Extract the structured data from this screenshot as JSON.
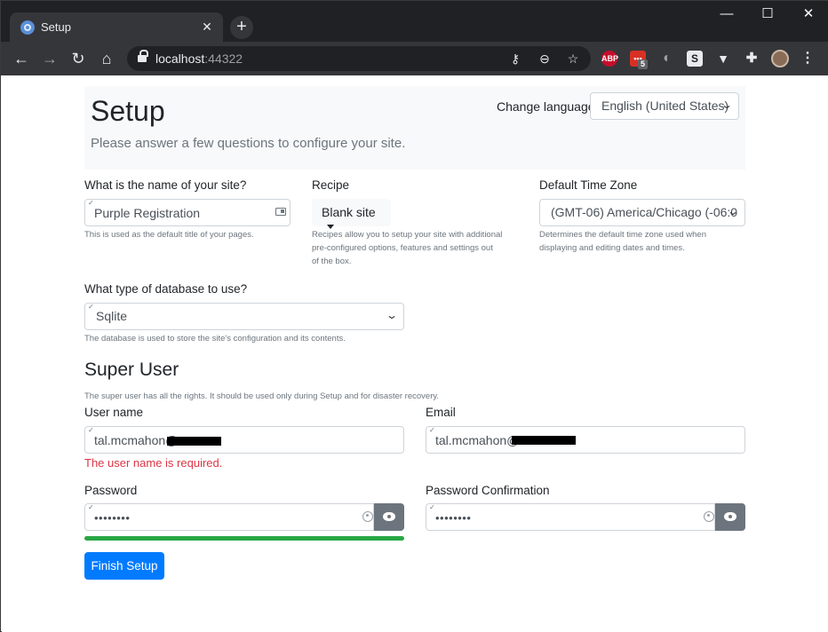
{
  "browser": {
    "tab_title": "Setup",
    "tab_close": "✕",
    "new_tab": "+",
    "url_host": "localhost",
    "url_port": ":44322",
    "controls": {
      "minimize": "—",
      "maximize": "☐",
      "close": "✕"
    },
    "extensions": {
      "abp": "ABP",
      "badge_count": "5",
      "s": "S"
    }
  },
  "header": {
    "title": "Setup",
    "subtitle": "Please answer a few questions to configure your site.",
    "language_label": "Change language",
    "language_value": "English (United States)"
  },
  "site": {
    "name_label": "What is the name of your site?",
    "name_value": "Purple Registration",
    "name_help": "This is used as the default title of your pages.",
    "recipe_label": "Recipe",
    "recipe_value": "Blank site",
    "recipe_help_1": "Recipes allow you to setup your site with additional",
    "recipe_help_2": "pre-configured options, features and settings out",
    "recipe_help_3": "of the box.",
    "tz_label": "Default Time Zone",
    "tz_value": "(GMT-06) America/Chicago (-06:0",
    "tz_help_1": "Determines the default time zone used when",
    "tz_help_2": "displaying and editing dates and times."
  },
  "database": {
    "label": "What type of database to use?",
    "value": "Sqlite",
    "help": "The database is used to store the site's configuration and its contents."
  },
  "super_user": {
    "heading": "Super User",
    "help": "The super user has all the rights. It should be used only during Setup and for disaster recovery.",
    "username_label": "User name",
    "username_value": "tal.mcmahon@",
    "username_error": "The user name is required.",
    "email_label": "Email",
    "email_value": "tal.mcmahon@",
    "password_label": "Password",
    "password_value": "••••••••",
    "password_confirm_label": "Password Confirmation",
    "password_confirm_value": "••••••••",
    "password_strength": 1.0
  },
  "actions": {
    "finish_label": "Finish Setup"
  },
  "colors": {
    "primary": "#007bff",
    "success": "#28a745",
    "danger": "#dc3545",
    "secondary": "#6c757d"
  }
}
